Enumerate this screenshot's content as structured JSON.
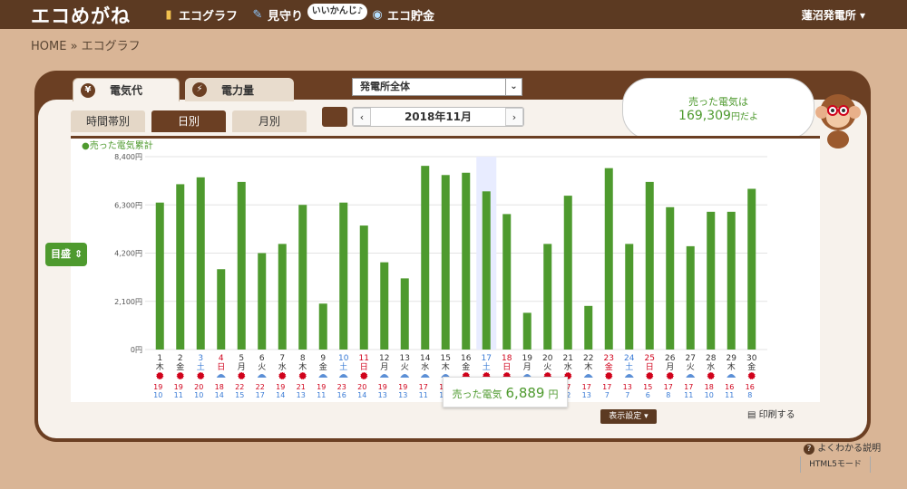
{
  "app": {
    "logo": "エコめがね",
    "station": "蓮沼発電所 ▾"
  },
  "nav": [
    {
      "label": "エコグラフ",
      "icon": "bar-chart-icon"
    },
    {
      "label": "見守り",
      "icon": "monitor-icon"
    },
    {
      "label": "エコ貯金",
      "icon": "coin-icon"
    }
  ],
  "mascot_badge": "いいかんじ♪",
  "breadcrumb": "HOME » エコグラフ",
  "main_tabs": [
    {
      "label": "電気代",
      "icon_char": "¥"
    },
    {
      "label": "電力量",
      "icon_char": "⚡"
    }
  ],
  "scope_select": "発電所全体",
  "sub_tabs": [
    "時間帯別",
    "日別",
    "月別"
  ],
  "date": {
    "label": "2018年11月",
    "prev": "‹",
    "next": "›"
  },
  "legend": "●売った電気累計",
  "y_axis_button": "目盛 ⇕",
  "balloon": {
    "line1": "売った電気は",
    "amount": "169,309",
    "suffix": "円だよ"
  },
  "tooltip": {
    "label": "売った電気",
    "value": "6,889",
    "unit": "円"
  },
  "buttons": {
    "display_settings": "表示設定 ▾",
    "print": "印刷する",
    "help": "よくわかる説明",
    "html5": "HTML5モード"
  },
  "colors": {
    "bar": "#4e9a2e",
    "brown": "#6b3f23",
    "holiday": "#d0021b",
    "saturday": "#3a7bd5"
  },
  "chart_data": {
    "type": "bar",
    "ylim": [
      0,
      8400
    ],
    "yticks": [
      "0円",
      "2,100円",
      "4,200円",
      "6,300円",
      "8,400円"
    ],
    "categories": [
      "1",
      "2",
      "3",
      "4",
      "5",
      "6",
      "7",
      "8",
      "9",
      "10",
      "11",
      "12",
      "13",
      "14",
      "15",
      "16",
      "17",
      "18",
      "19",
      "20",
      "21",
      "22",
      "23",
      "24",
      "25",
      "26",
      "27",
      "28",
      "29",
      "30"
    ],
    "weekdays": [
      "木",
      "金",
      "土",
      "日",
      "月",
      "火",
      "水",
      "木",
      "金",
      "土",
      "日",
      "月",
      "火",
      "水",
      "木",
      "金",
      "土",
      "日",
      "月",
      "火",
      "水",
      "木",
      "金",
      "土",
      "日",
      "月",
      "火",
      "水",
      "木",
      "金"
    ],
    "values": [
      6400,
      7200,
      7500,
      3500,
      7300,
      4200,
      4600,
      6300,
      2000,
      6400,
      5400,
      3800,
      3100,
      8000,
      7600,
      7700,
      6889,
      5900,
      1600,
      4600,
      6700,
      1900,
      7900,
      4600,
      7300,
      6200,
      4500,
      6000,
      6000,
      7000
    ],
    "highs": [
      19,
      19,
      20,
      18,
      22,
      22,
      19,
      21,
      19,
      23,
      20,
      19,
      19,
      17,
      19,
      19,
      19,
      18,
      19,
      17,
      17,
      17,
      17,
      13,
      15,
      17,
      17,
      18,
      16,
      16
    ],
    "lows": [
      10,
      11,
      10,
      14,
      15,
      17,
      14,
      13,
      11,
      16,
      14,
      13,
      13,
      11,
      13,
      13,
      13,
      11,
      12,
      12,
      12,
      13,
      7,
      7,
      6,
      8,
      11,
      10,
      11,
      8
    ],
    "weather": [
      "sun",
      "sun",
      "sun",
      "cloud",
      "sun",
      "cloud",
      "sun",
      "sun",
      "cloud",
      "cloud",
      "sun",
      "cloud",
      "cloud",
      "cloud",
      "cloud",
      "sun",
      "sun",
      "sun",
      "cloud",
      "sun",
      "sun",
      "cloud",
      "sun",
      "cloud",
      "sun",
      "sun",
      "cloud",
      "sun",
      "cloud",
      "sun"
    ],
    "day_types": [
      "w",
      "w",
      "sat",
      "hol",
      "w",
      "w",
      "w",
      "w",
      "w",
      "sat",
      "hol",
      "w",
      "w",
      "w",
      "w",
      "w",
      "sat",
      "hol",
      "w",
      "w",
      "w",
      "w",
      "hol",
      "sat",
      "hol",
      "w",
      "w",
      "w",
      "w",
      "w"
    ],
    "highlight_index": 16
  }
}
